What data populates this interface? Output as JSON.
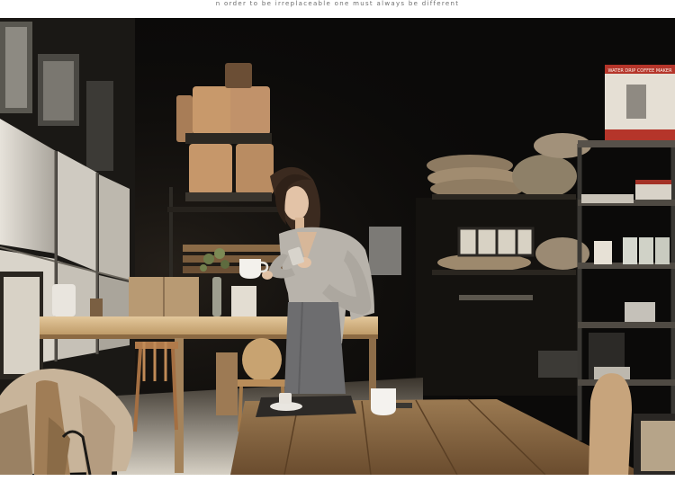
{
  "caption": "n order to be irreplaceable one must always be different",
  "photo": {
    "alt": "Woman in a grey blouse and pencil skirt holding a white cup and looking at her phone in a dim coffee roastery with wooden tables",
    "box_label": "WATER DRIP COFFEE MAKER"
  },
  "colors": {
    "background": "#ffffff",
    "caption_text": "#6d6d6d",
    "scene_dark": "#0b0a09",
    "wood": "#8a6a45",
    "window_light": "#dcd6cc",
    "blouse": "#b8b3ab",
    "skirt": "#6d6d6f"
  }
}
